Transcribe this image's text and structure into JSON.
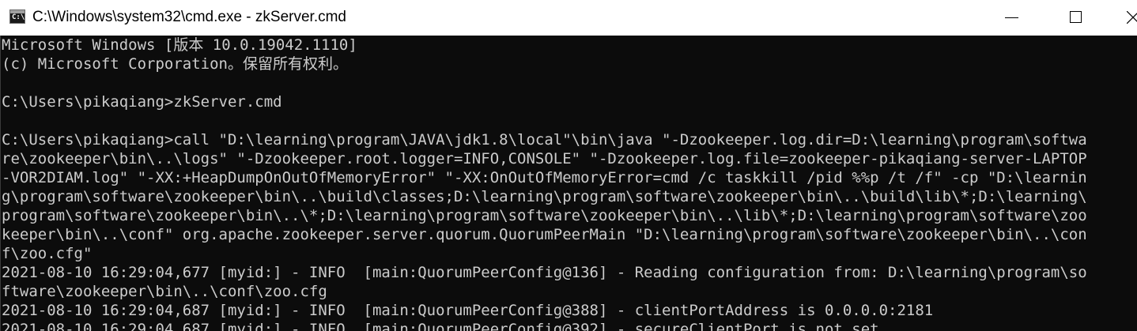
{
  "window": {
    "title": "C:\\Windows\\system32\\cmd.exe - zkServer.cmd",
    "icon": "cmd-console-icon",
    "controls": [
      "minimize-icon",
      "maximize-icon",
      "close-icon"
    ]
  },
  "colors": {
    "console_background": "#0c0c0c",
    "console_text": "#cccccc",
    "titlebar_background": "#ffffff"
  },
  "console": {
    "lines": [
      "Microsoft Windows [版本 10.0.19042.1110]",
      "(c) Microsoft Corporation。保留所有权利。",
      "",
      "C:\\Users\\pikaqiang>zkServer.cmd",
      "",
      "C:\\Users\\pikaqiang>call \"D:\\learning\\program\\JAVA\\jdk1.8\\local\"\\bin\\java \"-Dzookeeper.log.dir=D:\\learning\\program\\softwa",
      "re\\zookeeper\\bin\\..\\logs\" \"-Dzookeeper.root.logger=INFO,CONSOLE\" \"-Dzookeeper.log.file=zookeeper-pikaqiang-server-LAPTOP",
      "-VOR2DIAM.log\" \"-XX:+HeapDumpOnOutOfMemoryError\" \"-XX:OnOutOfMemoryError=cmd /c taskkill /pid %%p /t /f\" -cp \"D:\\learnin",
      "g\\program\\software\\zookeeper\\bin\\..\\build\\classes;D:\\learning\\program\\software\\zookeeper\\bin\\..\\build\\lib\\*;D:\\learning\\",
      "program\\software\\zookeeper\\bin\\..\\*;D:\\learning\\program\\software\\zookeeper\\bin\\..\\lib\\*;D:\\learning\\program\\software\\zoo",
      "keeper\\bin\\..\\conf\" org.apache.zookeeper.server.quorum.QuorumPeerMain \"D:\\learning\\program\\software\\zookeeper\\bin\\..\\con",
      "f\\zoo.cfg\"",
      "2021-08-10 16:29:04,677 [myid:] - INFO  [main:QuorumPeerConfig@136] - Reading configuration from: D:\\learning\\program\\so",
      "ftware\\zookeeper\\bin\\..\\conf\\zoo.cfg",
      "2021-08-10 16:29:04,687 [myid:] - INFO  [main:QuorumPeerConfig@388] - clientPortAddress is 0.0.0.0:2181",
      "2021-08-10 16:29:04,687 [myid:] - INFO  [main:QuorumPeerConfig@392] - secureClientPort is not set"
    ]
  }
}
